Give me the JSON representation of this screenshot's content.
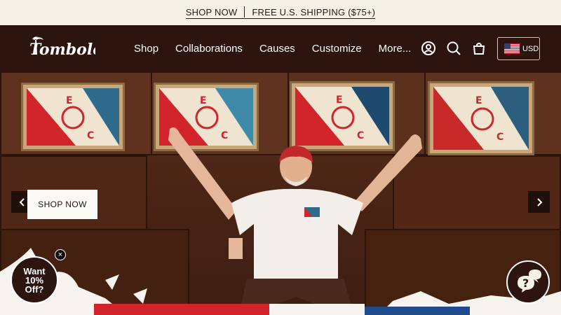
{
  "announcement": {
    "shop_now": "SHOP NOW",
    "shipping": "FREE U.S. SHIPPING ($75+)"
  },
  "header": {
    "logo_text": "Tombolo",
    "nav": [
      {
        "label": "Shop"
      },
      {
        "label": "Collaborations"
      },
      {
        "label": "Causes"
      },
      {
        "label": "Customize"
      },
      {
        "label": "More..."
      }
    ],
    "currency": "USD",
    "icons": [
      "account-icon",
      "search-icon",
      "cart-icon",
      "us-flag-icon"
    ]
  },
  "hero": {
    "cta": "SHOP NOW",
    "prev_icon": "chevron-left-icon",
    "next_icon": "chevron-right-icon"
  },
  "promo": {
    "line1": "Want",
    "line2": "10%",
    "line3": "Off?",
    "close": "×"
  },
  "chat": {
    "icon": "chat-bubbles-icon"
  },
  "colors": {
    "header_bg": "#2c150f",
    "announcement_bg": "#f6f1e6",
    "flag_red": "#d1242b",
    "flag_blue": "#2f6b8c"
  }
}
